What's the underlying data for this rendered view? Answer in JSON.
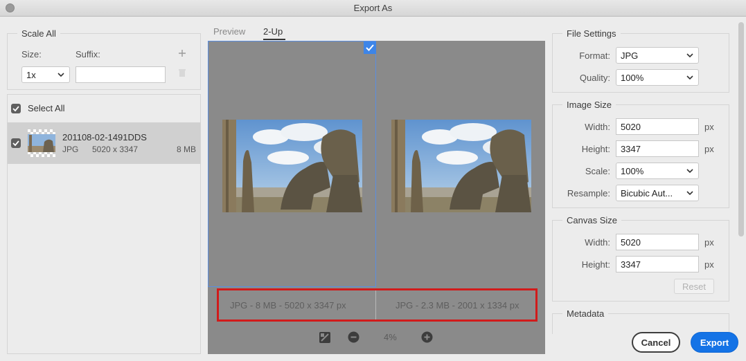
{
  "window": {
    "title": "Export As"
  },
  "left": {
    "scale_all_title": "Scale All",
    "size_label": "Size:",
    "suffix_label": "Suffix:",
    "size_value": "1x",
    "suffix_value": "",
    "select_all_label": "Select All",
    "select_all_checked": true,
    "files": [
      {
        "name": "201108-02-1491DDS",
        "format": "JPG",
        "dimensions": "5020 x 3347",
        "size": "8 MB",
        "checked": true
      }
    ]
  },
  "tabs": [
    {
      "label": "Preview",
      "active": false
    },
    {
      "label": "2-Up",
      "active": true
    }
  ],
  "preview": {
    "left_info": "JPG - 8 MB - 5020 x 3347 px",
    "right_info": "JPG - 2.3 MB - 2001 x 1334 px",
    "zoom": "4%"
  },
  "file_settings": {
    "title": "File Settings",
    "format_label": "Format:",
    "format_value": "JPG",
    "quality_label": "Quality:",
    "quality_value": "100%"
  },
  "image_size": {
    "title": "Image Size",
    "width_label": "Width:",
    "width_value": "5020",
    "height_label": "Height:",
    "height_value": "3347",
    "scale_label": "Scale:",
    "scale_value": "100%",
    "resample_label": "Resample:",
    "resample_value": "Bicubic Aut...",
    "unit": "px"
  },
  "canvas_size": {
    "title": "Canvas Size",
    "width_label": "Width:",
    "width_value": "5020",
    "height_label": "Height:",
    "height_value": "3347",
    "unit": "px",
    "reset_label": "Reset"
  },
  "metadata": {
    "title": "Metadata"
  },
  "buttons": {
    "cancel": "Cancel",
    "export": "Export"
  },
  "colors": {
    "accent": "#1473e6",
    "highlight": "#d11b1b",
    "selection": "#5b8ee0"
  }
}
